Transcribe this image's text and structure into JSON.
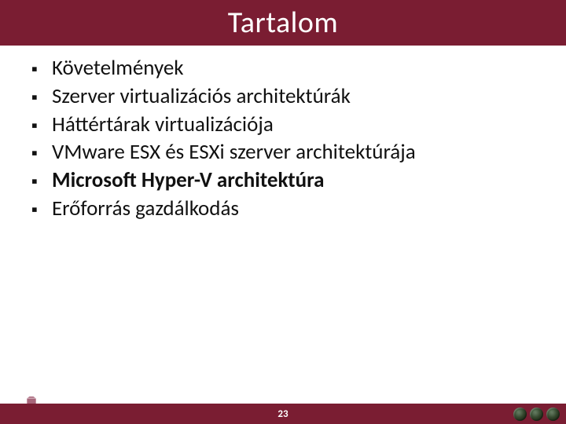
{
  "colors": {
    "brand": "#7a1d32",
    "text": "#111111",
    "title_text": "#ffffff"
  },
  "title": "Tartalom",
  "bullets": [
    {
      "text": "Követelmények",
      "bold": false
    },
    {
      "text": "Szerver virtualizációs architektúrák",
      "bold": false
    },
    {
      "text": "Háttértárak virtualizációja",
      "bold": false
    },
    {
      "text": "VMware ESX és ESXi szerver architektúrája",
      "bold": false
    },
    {
      "text": "Microsoft Hyper-V architektúra",
      "bold": true
    },
    {
      "text": "Erőforrás gazdálkodás",
      "bold": false
    }
  ],
  "page_number": "23",
  "logo_left_alt": "university-building-logo",
  "badges": [
    "badge-1",
    "badge-2",
    "badge-3"
  ]
}
